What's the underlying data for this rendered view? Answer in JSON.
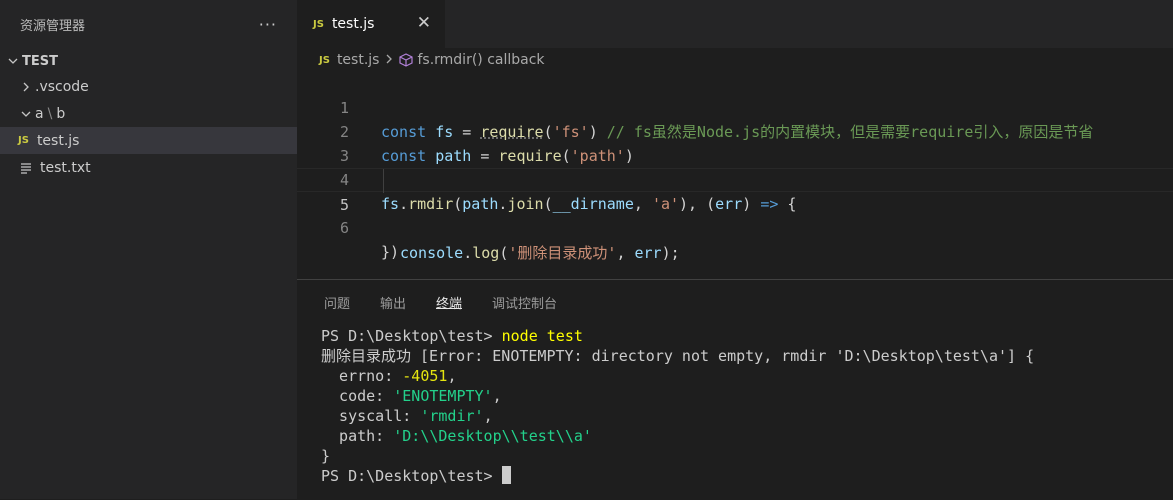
{
  "sidebar": {
    "title": "资源管理器",
    "more": "···",
    "root": "TEST",
    "items": [
      {
        "label": ".vscode"
      },
      {
        "label_a": "a",
        "label_b": "b"
      },
      {
        "badge": "JS",
        "label": "test.js"
      },
      {
        "label": "test.txt"
      }
    ]
  },
  "tab": {
    "badge": "JS",
    "label": "test.js",
    "close": "✕"
  },
  "breadcrumb": {
    "badge": "JS",
    "file": "test.js",
    "symbol": "fs.rmdir() callback"
  },
  "editor": {
    "line_numbers": [
      "1",
      "2",
      "3",
      "4",
      "5",
      "6"
    ],
    "l1": {
      "kw": "const",
      "var": "fs",
      "eq": " = ",
      "fn": "require",
      "p1": "(",
      "str": "'fs'",
      "p2": ") ",
      "cmt": "// fs虽然是Node.js的内置模块，但是需要require引入，原因是节省"
    },
    "l2": {
      "kw": "const",
      "var": "path",
      "eq": " = ",
      "fn": "require",
      "p1": "(",
      "str": "'path'",
      "p2": ")"
    },
    "l4": {
      "v1": "fs",
      "d1": ".",
      "f1": "rmdir",
      "p1": "(",
      "v2": "path",
      "d2": ".",
      "f2": "join",
      "p2": "(",
      "v3": "__dirname",
      "c1": ", ",
      "s1": "'a'",
      "p3": "), (",
      "v4": "err",
      "p4": ") ",
      "ar": "=>",
      "p5": " {"
    },
    "l5": {
      "v1": "console",
      "d1": ".",
      "f1": "log",
      "p1": "(",
      "s1": "'删除目录成功'",
      "c1": ", ",
      "v2": "err",
      "p2": ");"
    },
    "l6": "})"
  },
  "panel": {
    "tabs": [
      "问题",
      "输出",
      "终端",
      "调试控制台"
    ],
    "active_tab": "终端",
    "terminal": {
      "prompt1": "PS D:\\Desktop\\test> ",
      "cmd": "node test",
      "line2": "删除目录成功 [Error: ENOTEMPTY: directory not empty, rmdir 'D:\\Desktop\\test\\a'] {",
      "errno_key": "  errno: ",
      "errno_val": "-4051",
      "errno_end": ",",
      "code_key": "  code: ",
      "code_val": "'ENOTEMPTY'",
      "code_end": ",",
      "syscall_key": "  syscall: ",
      "syscall_val": "'rmdir'",
      "syscall_end": ",",
      "path_key": "  path: ",
      "path_val": "'D:\\\\Desktop\\\\test\\\\a'",
      "close": "}",
      "prompt2": "PS D:\\Desktop\\test> "
    }
  },
  "colors": {
    "keyword": "#569cd6",
    "string": "#ce9178",
    "comment": "#6a9955",
    "function": "#dcdcaa",
    "js_badge": "#cbcb41"
  }
}
